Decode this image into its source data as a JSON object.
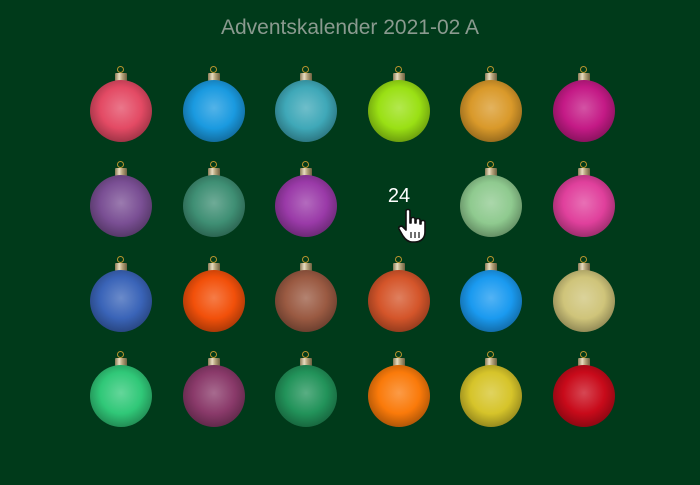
{
  "title": "Adventskalender 2021-02 A",
  "open_door_number": "24",
  "ornaments": [
    {
      "color": "#e34a64"
    },
    {
      "color": "#1a9ae0"
    },
    {
      "color": "#3fa8b8"
    },
    {
      "color": "#9ae014"
    },
    {
      "color": "#d9992a"
    },
    {
      "color": "#c41a86"
    },
    {
      "color": "#7a4f94"
    },
    {
      "color": "#3f8f74"
    },
    {
      "color": "#9a3aa8"
    },
    {
      "color": null
    },
    {
      "color": "#8fca8f"
    },
    {
      "color": "#e0409c"
    },
    {
      "color": "#3a64b8"
    },
    {
      "color": "#f2500a"
    },
    {
      "color": "#9a5a42"
    },
    {
      "color": "#d4552a"
    },
    {
      "color": "#1a9af0"
    },
    {
      "color": "#cfc47a"
    },
    {
      "color": "#30c878"
    },
    {
      "color": "#8a3a6a"
    },
    {
      "color": "#22935a"
    },
    {
      "color": "#fa7a0a"
    },
    {
      "color": "#d6c42a"
    },
    {
      "color": "#c80a1a"
    }
  ]
}
